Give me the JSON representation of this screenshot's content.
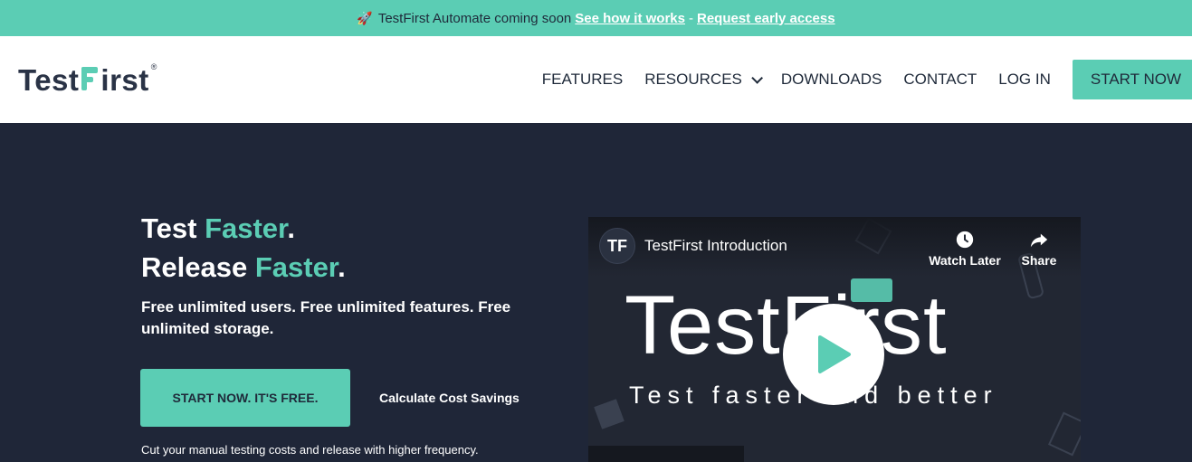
{
  "announcement": {
    "icon": "rocket-icon",
    "text": "TestFirst Automate coming soon",
    "link_how": "See how it works",
    "separator": "-",
    "link_access": "Request early access"
  },
  "nav": {
    "logo_part1": "Test",
    "logo_part2": "irst",
    "logo_reg": "®",
    "items": [
      "FEATURES",
      "RESOURCES",
      "DOWNLOADS",
      "CONTACT",
      "LOG IN"
    ],
    "start": "START NOW"
  },
  "hero": {
    "line1_a": "Test ",
    "line1_b": "Faster",
    "line1_c": ".",
    "line2_a": "Release ",
    "line2_b": "Faster",
    "line2_c": ".",
    "sub": "Free unlimited users. Free unlimited features. Free unlimited storage.",
    "cta": "START NOW. IT'S FREE.",
    "calc": "Calculate Cost Savings",
    "foot": "Cut your manual testing costs and release with higher frequency."
  },
  "video": {
    "channel_initials": "TF",
    "title": "TestFirst Introduction",
    "watch_later": "Watch Later",
    "share": "Share",
    "big_word": "TestFirst",
    "tagline": "Test faster and better"
  },
  "colors": {
    "accent": "#5bcdb4",
    "dark": "#1f2638",
    "nav_text": "#1f2a3a"
  }
}
